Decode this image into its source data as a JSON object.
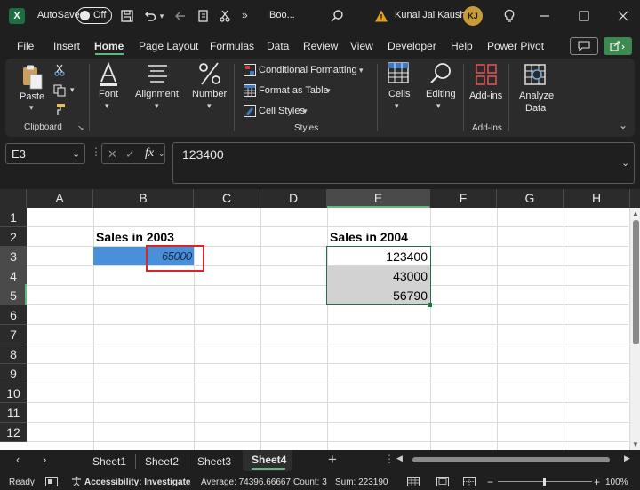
{
  "titlebar": {
    "autosave_label": "AutoSave",
    "autosave_state": "Off",
    "filename": "Boo...",
    "user_name": "Kunal Jai Kaushik",
    "user_initials": "KJ",
    "overflow": "»"
  },
  "menu": {
    "tabs": [
      "File",
      "Insert",
      "Home",
      "Page Layout",
      "Formulas",
      "Data",
      "Review",
      "View",
      "Developer",
      "Help",
      "Power Pivot"
    ],
    "active": "Home"
  },
  "ribbon": {
    "paste": "Paste",
    "clipboard_group": "Clipboard",
    "font": "Font",
    "alignment": "Alignment",
    "number": "Number",
    "conditional_formatting": "Conditional Formatting",
    "format_as_table": "Format as Table",
    "cell_styles": "Cell Styles",
    "styles_group": "Styles",
    "cells": "Cells",
    "editing": "Editing",
    "addins": "Add-ins",
    "addins_group": "Add-ins",
    "analyze_data_line1": "Analyze",
    "analyze_data_line2": "Data"
  },
  "formula_bar": {
    "name_box": "E3",
    "fx": "fx",
    "value": "123400"
  },
  "grid": {
    "columns": [
      "A",
      "B",
      "C",
      "D",
      "E",
      "F",
      "G",
      "H"
    ],
    "selected_column": "E",
    "rows": [
      "1",
      "2",
      "3",
      "4",
      "5",
      "6",
      "7",
      "8",
      "9",
      "10",
      "11",
      "12"
    ],
    "selected_rows": [
      "3",
      "4",
      "5"
    ],
    "b2": "Sales in 2003",
    "b3": "65000",
    "e2": "Sales in 2004",
    "e3": "123400",
    "e4": "43000",
    "e5": "56790"
  },
  "sheets": {
    "tabs": [
      "Sheet1",
      "Sheet2",
      "Sheet3",
      "Sheet4"
    ],
    "active": "Sheet4",
    "add": "+"
  },
  "status": {
    "ready": "Ready",
    "accessibility": "Accessibility: Investigate",
    "average": "Average: 74396.66667",
    "count": "Count: 3",
    "sum": "Sum: 223190",
    "zoom": "100%"
  },
  "colors": {
    "accent_green": "#5fb97a",
    "excel_green": "#1d6f42",
    "selection_blue": "#4a90d9",
    "highlight_red": "#d9262c"
  }
}
